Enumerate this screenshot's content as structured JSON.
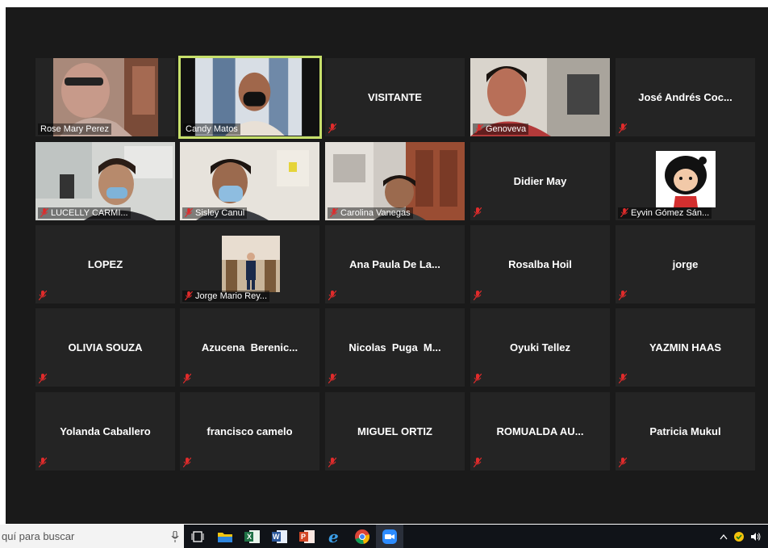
{
  "participants": [
    {
      "name": "Rose Mary Perez",
      "video": true,
      "muted": false
    },
    {
      "name": "Candy Matos",
      "video": true,
      "muted": false,
      "active_speaker": true
    },
    {
      "name": "VISITANTE",
      "video": false,
      "muted": true
    },
    {
      "name": "Genoveva",
      "video": true,
      "muted": true
    },
    {
      "name": "José Andrés Coc...",
      "video": false,
      "muted": true
    },
    {
      "name": "LUCELLY CARMI...",
      "video": true,
      "muted": true
    },
    {
      "name": "Sisley Canul",
      "video": true,
      "muted": true
    },
    {
      "name": "Carolina Vanegas",
      "video": true,
      "muted": true
    },
    {
      "name": "Didier May",
      "video": false,
      "muted": true
    },
    {
      "name": "Eyvin Gómez Sán...",
      "video": false,
      "avatar": true,
      "muted": true
    },
    {
      "name": "LOPEZ",
      "video": false,
      "muted": true
    },
    {
      "name": "Jorge Mario Rey...",
      "video": false,
      "avatar": true,
      "muted": true
    },
    {
      "name": "Ana Paula De La...",
      "video": false,
      "muted": true
    },
    {
      "name": "Rosalba Hoil",
      "video": false,
      "muted": true
    },
    {
      "name": "jorge",
      "video": false,
      "muted": true
    },
    {
      "name": "OLIVIA SOUZA",
      "video": false,
      "muted": true
    },
    {
      "name": "Azucena  Berenic...",
      "video": false,
      "muted": true
    },
    {
      "name": "Nicolas  Puga  M...",
      "video": false,
      "muted": true
    },
    {
      "name": "Oyuki Tellez",
      "video": false,
      "muted": true
    },
    {
      "name": "YAZMIN HAAS",
      "video": false,
      "muted": true
    },
    {
      "name": "Yolanda Caballero",
      "video": false,
      "muted": true
    },
    {
      "name": "francisco camelo",
      "video": false,
      "muted": true
    },
    {
      "name": "MIGUEL ORTIZ",
      "video": false,
      "muted": true
    },
    {
      "name": "ROMUALDA AU...",
      "video": false,
      "muted": true
    },
    {
      "name": "Patricia Mukul",
      "video": false,
      "muted": true
    }
  ],
  "taskbar": {
    "search_placeholder": "quí para buscar",
    "apps": [
      "task-view-icon",
      "file-explorer-icon",
      "excel-icon",
      "word-icon",
      "powerpoint-icon",
      "edge-icon",
      "chrome-icon",
      "zoom-icon"
    ]
  },
  "colors": {
    "tile_bg": "#242424",
    "window_bg": "#1a1a1a",
    "active_speaker_border": "#c7e06b",
    "mute_red": "#e02b2b"
  }
}
